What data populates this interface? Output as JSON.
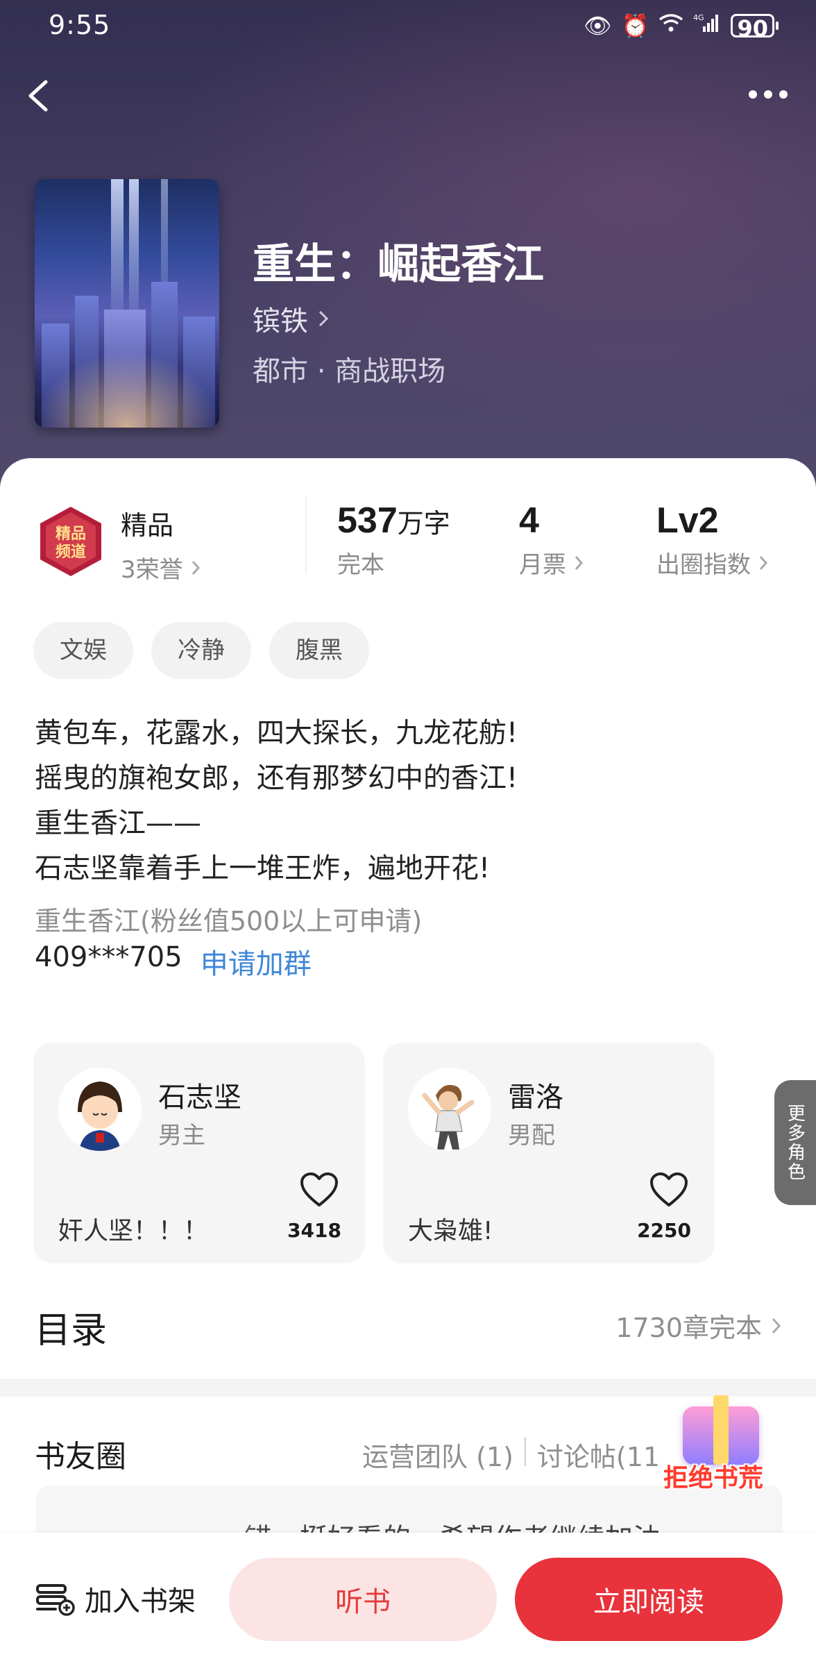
{
  "status_bar": {
    "time": "9:55",
    "battery": "90",
    "network": "4G"
  },
  "header": {
    "back_icon": "chevron-left-icon",
    "more_icon": "more-dots-icon"
  },
  "book": {
    "title": "重生：崛起香江",
    "author": "镔铁",
    "genre": "都市 · 商战职场"
  },
  "stats": {
    "quality_label": "精品",
    "honors": "3荣誉",
    "word_count": "537",
    "word_unit": "万字",
    "status": "完本",
    "monthly_votes": "4",
    "monthly_votes_label": "月票",
    "circle_level": "Lv2",
    "circle_level_label": "出圈指数"
  },
  "tags": [
    "文娱",
    "冷静",
    "腹黑"
  ],
  "description": [
    "黄包车，花露水，四大探长，九龙花舫!",
    "摇曳的旗袍女郎，还有那梦幻中的香江!",
    "重生香江——",
    "石志坚靠着手上一堆王炸，遍地开花!"
  ],
  "fan_group": {
    "note": "重生香江(粉丝值500以上可申请)",
    "number": "409***705",
    "apply_label": "申请加群"
  },
  "roles": [
    {
      "name": "石志坚",
      "type": "男主",
      "quote": "奸人坚！！！",
      "likes": "3418"
    },
    {
      "name": "雷洛",
      "type": "男配",
      "quote": "大枭雄!",
      "likes": "2250"
    }
  ],
  "more_roles_label": "更多角色",
  "toc": {
    "title": "目录",
    "summary": "1730章完本"
  },
  "book_circle": {
    "title": "书友圈",
    "ops_team": "运营团队 (1)",
    "posts": "讨论帖(11",
    "preview": "错，挺好看的，希望作者继续加油"
  },
  "promo_label": "拒绝书荒",
  "bottom_bar": {
    "shelf_label": "加入书架",
    "listen_label": "听书",
    "read_label": "立即阅读"
  },
  "colors": {
    "accent": "#e8323c",
    "link": "#3f86d9",
    "hero_bg": "#3f3a5e"
  }
}
